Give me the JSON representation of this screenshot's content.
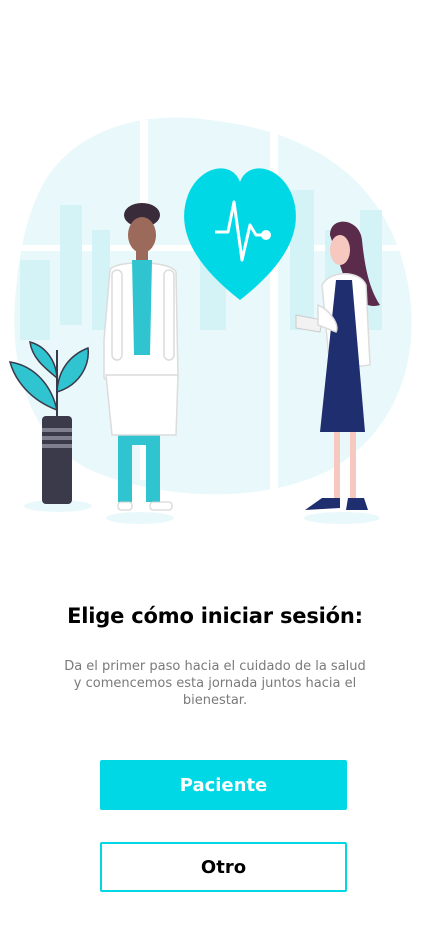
{
  "illustration": {
    "icon": "doctors-illustration",
    "accent_color": "#00d8e6",
    "background_color": "#e9f9fb"
  },
  "login": {
    "title": "Elige cómo iniciar sesión:",
    "description": "Da el primer paso hacia el cuidado de la salud y comencemos esta jornada juntos hacia el bienestar.",
    "patient_label": "Paciente",
    "other_label": "Otro"
  }
}
